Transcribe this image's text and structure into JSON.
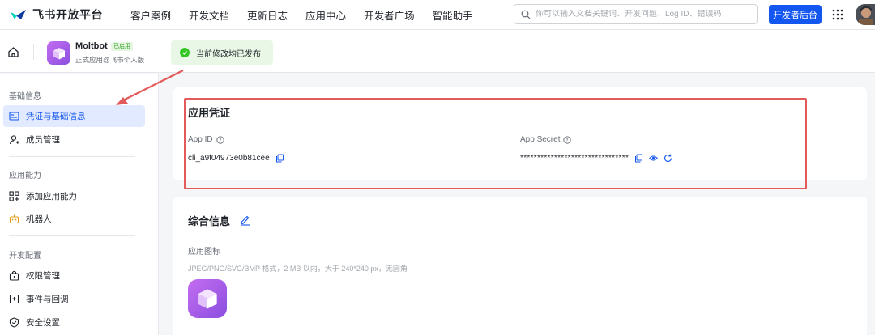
{
  "topnav": {
    "brand": "飞书开放平台",
    "links": [
      "客户案例",
      "开发文档",
      "更新日志",
      "应用中心",
      "开发者广场",
      "智能助手"
    ],
    "search_placeholder": "你可以输入文档关键词、开发问题、Log ID、错误码",
    "console_button": "开发者后台",
    "icons": [
      "feishu-logo",
      "search-icon",
      "apps-grid-icon",
      "user-avatar"
    ]
  },
  "app_header": {
    "app_name": "Moltbot",
    "badge": "已启用",
    "subtitle": "正式应用@飞书个人版",
    "publish_status": "当前修改均已发布"
  },
  "sidebar": {
    "groups": [
      {
        "title": "基础信息",
        "items": [
          {
            "label": "凭证与基础信息",
            "icon": "id-card-icon",
            "active": true
          },
          {
            "label": "成员管理",
            "icon": "user-add-icon",
            "active": false
          }
        ]
      },
      {
        "title": "应用能力",
        "items": [
          {
            "label": "添加应用能力",
            "icon": "apps-add-icon",
            "active": false
          },
          {
            "label": "机器人",
            "icon": "robot-icon",
            "active": false
          }
        ]
      },
      {
        "title": "开发配置",
        "items": [
          {
            "label": "权限管理",
            "icon": "lock-icon",
            "active": false
          },
          {
            "label": "事件与回调",
            "icon": "event-icon",
            "active": false
          },
          {
            "label": "安全设置",
            "icon": "shield-icon",
            "active": false
          }
        ]
      }
    ]
  },
  "credentials": {
    "title": "应用凭证",
    "app_id_label": "App ID",
    "app_id_value": "cli_a9f04973e0b81cee",
    "app_secret_label": "App Secret",
    "app_secret_value": "********************************"
  },
  "general_info": {
    "title": "综合信息",
    "icon_label": "应用图标",
    "icon_hint": "JPEG/PNG/SVG/BMP 格式，2 MB 以内，大于 240*240 px，无圆角"
  },
  "colors": {
    "accent": "#1456f0",
    "highlight_border": "#e35a5a",
    "success": "#34c724",
    "app_icon": "#a65ee8"
  }
}
